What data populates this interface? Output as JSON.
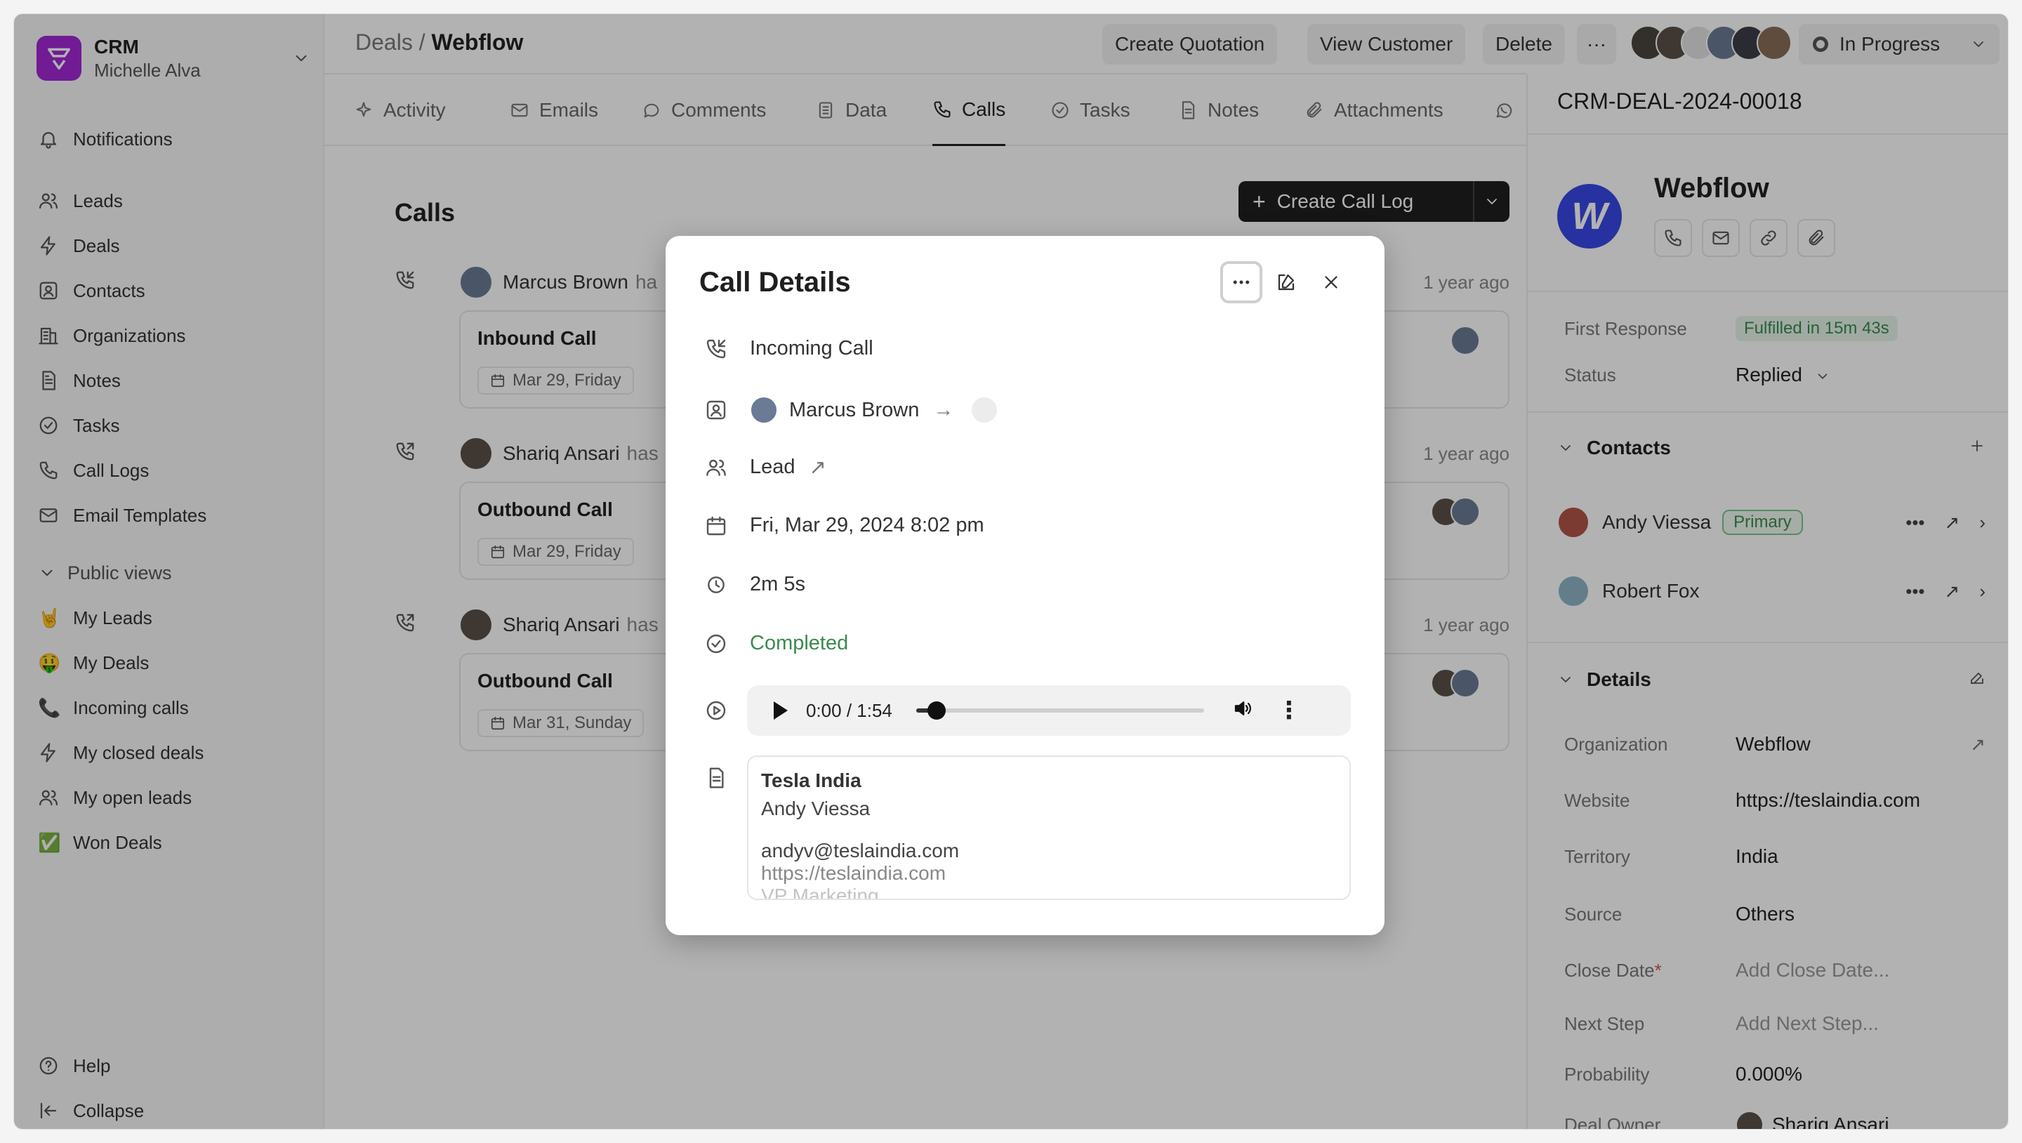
{
  "app": {
    "name": "CRM",
    "user": "Michelle Alva",
    "accent": "#a328d6"
  },
  "sidebar": {
    "top_items": [
      {
        "label": "Notifications",
        "icon": "bell-icon"
      }
    ],
    "items": [
      {
        "label": "Leads",
        "icon": "users-icon"
      },
      {
        "label": "Deals",
        "icon": "bolt-icon"
      },
      {
        "label": "Contacts",
        "icon": "contact-icon"
      },
      {
        "label": "Organizations",
        "icon": "building-icon"
      },
      {
        "label": "Notes",
        "icon": "note-icon"
      },
      {
        "label": "Tasks",
        "icon": "check-circle-icon"
      },
      {
        "label": "Call Logs",
        "icon": "phone-icon"
      },
      {
        "label": "Email Templates",
        "icon": "mail-icon"
      }
    ],
    "public_views_label": "Public views",
    "public_views": [
      {
        "label": "My Leads",
        "emoji": "🤘"
      },
      {
        "label": "My Deals",
        "emoji": "🤑"
      },
      {
        "label": "Incoming calls",
        "emoji": "📞"
      },
      {
        "label": "My closed deals",
        "icon": "bolt-icon"
      },
      {
        "label": "My open leads",
        "icon": "users-icon"
      },
      {
        "label": "Won Deals",
        "emoji": "✅"
      }
    ],
    "help": "Help",
    "collapse": "Collapse"
  },
  "header": {
    "breadcrumb_root": "Deals",
    "breadcrumb_sep": "/",
    "breadcrumb_current": "Webflow",
    "create_quotation": "Create Quotation",
    "view_customer": "View Customer",
    "delete": "Delete",
    "more": "···",
    "status": "In Progress"
  },
  "tabs": [
    {
      "label": "Activity",
      "icon": "sparkle-icon"
    },
    {
      "label": "Emails",
      "icon": "mail-icon"
    },
    {
      "label": "Comments",
      "icon": "comment-icon"
    },
    {
      "label": "Data",
      "icon": "data-icon"
    },
    {
      "label": "Calls",
      "icon": "phone-icon",
      "active": true
    },
    {
      "label": "Tasks",
      "icon": "check-circle-icon"
    },
    {
      "label": "Notes",
      "icon": "note-icon"
    },
    {
      "label": "Attachments",
      "icon": "paperclip-icon"
    }
  ],
  "calls": {
    "title": "Calls",
    "create_label": "Create Call Log",
    "entries": [
      {
        "who": "Marcus Brown",
        "verb": "ha",
        "ago": "1 year ago",
        "type": "Inbound Call",
        "date": "Mar 29, Friday"
      },
      {
        "who": "Shariq Ansari",
        "verb": "has",
        "ago": "1 year ago",
        "type": "Outbound Call",
        "date": "Mar 29, Friday"
      },
      {
        "who": "Shariq Ansari",
        "verb": "has",
        "ago": "1 year ago",
        "type": "Outbound Call",
        "date": "Mar 31, Sunday"
      }
    ]
  },
  "panel": {
    "deal_id": "CRM-DEAL-2024-00018",
    "org_initial": "W",
    "org_name": "Webflow",
    "first_response_label": "First Response",
    "first_response_value": "Fulfilled in 15m 43s",
    "status_label": "Status",
    "status_value": "Replied",
    "contacts_title": "Contacts",
    "contacts": [
      {
        "name": "Andy Viessa",
        "badge": "Primary"
      },
      {
        "name": "Robert Fox",
        "badge": ""
      }
    ],
    "details_title": "Details",
    "details": [
      {
        "label": "Organization",
        "value": "Webflow",
        "placeholder": false
      },
      {
        "label": "Website",
        "value": "https://teslaindia.com",
        "placeholder": false
      },
      {
        "label": "Territory",
        "value": "India",
        "placeholder": false
      },
      {
        "label": "Source",
        "value": "Others",
        "placeholder": false
      },
      {
        "label": "Close Date",
        "value": "Add Close Date...",
        "placeholder": true,
        "required": "*"
      },
      {
        "label": "Next Step",
        "value": "Add Next Step...",
        "placeholder": true
      },
      {
        "label": "Probability",
        "value": "0.000%",
        "placeholder": false
      },
      {
        "label": "Deal Owner",
        "value": "Shariq Ansari",
        "placeholder": false
      }
    ]
  },
  "modal": {
    "title": "Call Details",
    "call_type": "Incoming Call",
    "caller": "Marcus Brown",
    "reference": "Lead",
    "datetime": "Fri, Mar 29, 2024 8:02 pm",
    "duration": "2m 5s",
    "status": "Completed",
    "audio_time": "0:00 / 1:54",
    "audio_progress": 0.07,
    "note_title": "Tesla India",
    "note_lines": [
      "Andy Viessa",
      "",
      "andyv@teslaindia.com",
      "https://teslaindia.com",
      "VP Marketing"
    ]
  }
}
